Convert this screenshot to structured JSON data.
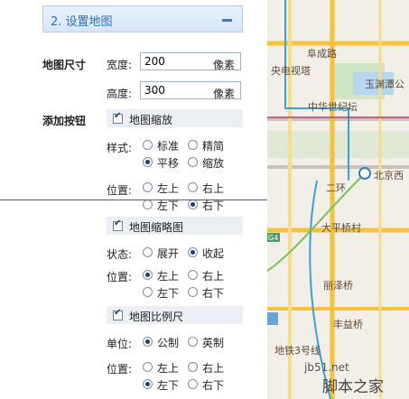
{
  "section": {
    "title": "2. 设置地图"
  },
  "map_size": {
    "label": "地图尺寸",
    "width_label": "宽度:",
    "width_value": "200",
    "height_label": "高度:",
    "height_value": "300",
    "unit": "像素"
  },
  "add_buttons": {
    "label": "添加按钮",
    "zoom": {
      "label": "地图缩放",
      "style_label": "样式:",
      "style_options": [
        "标准",
        "精简",
        "平移",
        "缩放"
      ],
      "selected_style": "平移",
      "position_label": "位置:",
      "position_options": [
        "左上",
        "右上",
        "左下",
        "右下"
      ],
      "selected_position": "右下"
    },
    "overview": {
      "label": "地图缩略图",
      "state_label": "状态:",
      "state_options": [
        "展开",
        "收起"
      ],
      "selected_state": "收起",
      "position_label": "位置:",
      "position_options": [
        "左上",
        "右上",
        "左下",
        "右下"
      ],
      "selected_position": "左上"
    },
    "scale": {
      "label": "地图比例尺",
      "unit_label": "单位:",
      "unit_options": [
        "公制",
        "英制"
      ],
      "selected_unit": "公制",
      "position_label": "位置:",
      "position_options": [
        "左上",
        "右上",
        "左下",
        "右下"
      ],
      "selected_position": "左下"
    }
  },
  "map_labels": [
    "阜成路",
    "央电视塔",
    "玉渊潭公",
    "中华世纪坛",
    "二环",
    "北京西",
    "大平桥村",
    "丽泽桥",
    "丰益桥",
    "地铁3号线",
    "G4"
  ],
  "watermark": {
    "site": "jb51.net",
    "brand": "脚本之家"
  },
  "colors": {
    "header_text": "#2f6fb5",
    "red_line": "#c23030",
    "road": "#f5c23c",
    "subway": "#3aa1d9"
  }
}
